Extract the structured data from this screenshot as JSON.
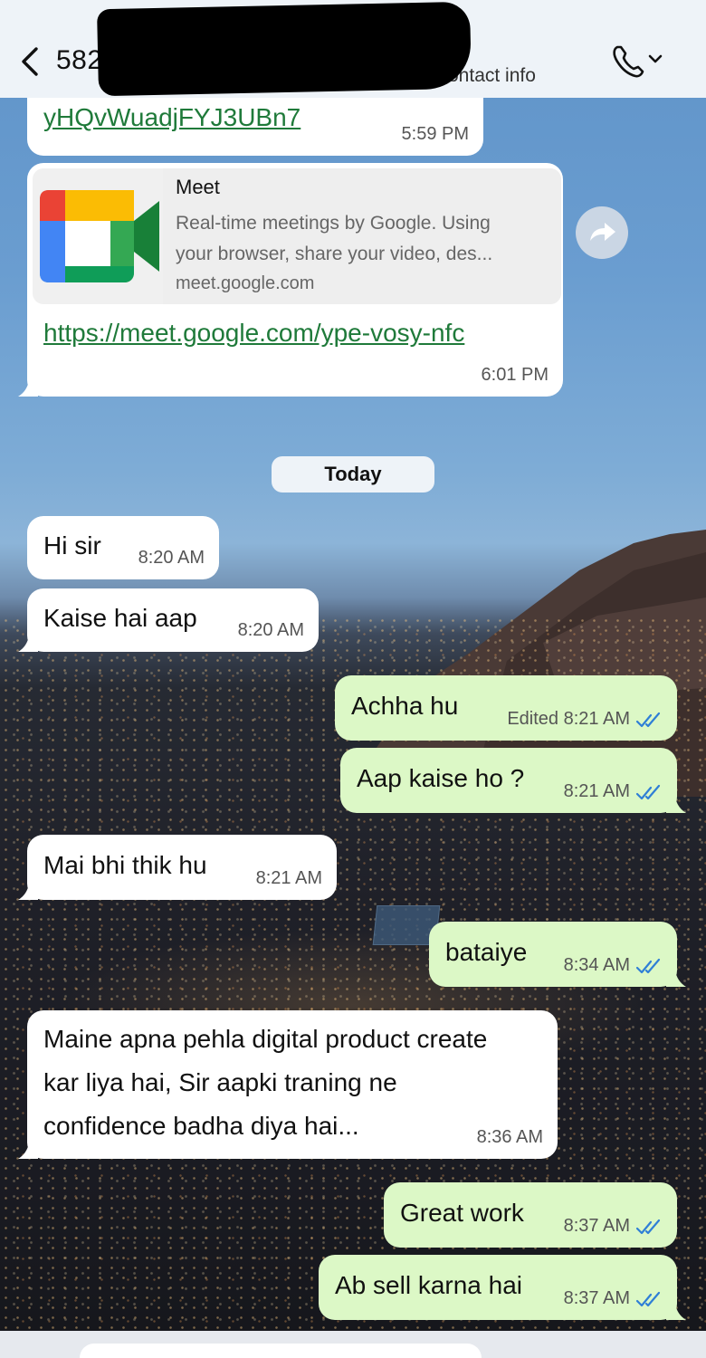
{
  "header": {
    "contact_name": "582",
    "subtitle": "or contact info"
  },
  "messages": [
    {
      "direction": "in",
      "link": "yHQvWuadjFYJ3UBn7",
      "time": "5:59 PM"
    },
    {
      "direction": "in",
      "preview_title": "Meet",
      "preview_desc_line1": "Real-time meetings by Google. Using",
      "preview_desc_line2": "your browser, share your video, des...",
      "preview_domain": "meet.google.com",
      "link": "https://meet.google.com/ype-vosy-nfc",
      "time": "6:01 PM"
    },
    {
      "direction": "in",
      "text": "Hi sir",
      "time": "8:20 AM"
    },
    {
      "direction": "in",
      "text": "Kaise hai aap",
      "time": "8:20 AM"
    },
    {
      "direction": "out",
      "text": "Achha hu",
      "time": "Edited 8:21 AM"
    },
    {
      "direction": "out",
      "text": "Aap kaise ho ?",
      "time": "8:21 AM"
    },
    {
      "direction": "in",
      "text": "Mai bhi thik hu",
      "time": "8:21 AM"
    },
    {
      "direction": "out",
      "text": "bataiye",
      "time": "8:34 AM"
    },
    {
      "direction": "in",
      "line1": "Maine apna pehla digital product create",
      "line2": "kar liya hai, Sir aapki traning ne",
      "line3": "confidence badha diya hai...",
      "time": "8:36 AM"
    },
    {
      "direction": "out",
      "text": "Great work",
      "time": "8:37 AM"
    },
    {
      "direction": "out",
      "text": "Ab sell karna hai",
      "time": "8:37 AM"
    }
  ],
  "date_separator": "Today",
  "icons": {
    "back": "chevron-left-icon",
    "call": "phone-icon",
    "forward": "forward-arrow-icon",
    "read_receipt": "double-check-icon"
  },
  "colors": {
    "incoming_bubble": "#ffffff",
    "outgoing_bubble": "#dcf8c6",
    "link": "#1f7a3a",
    "read_receipt": "#2f7fd6"
  }
}
